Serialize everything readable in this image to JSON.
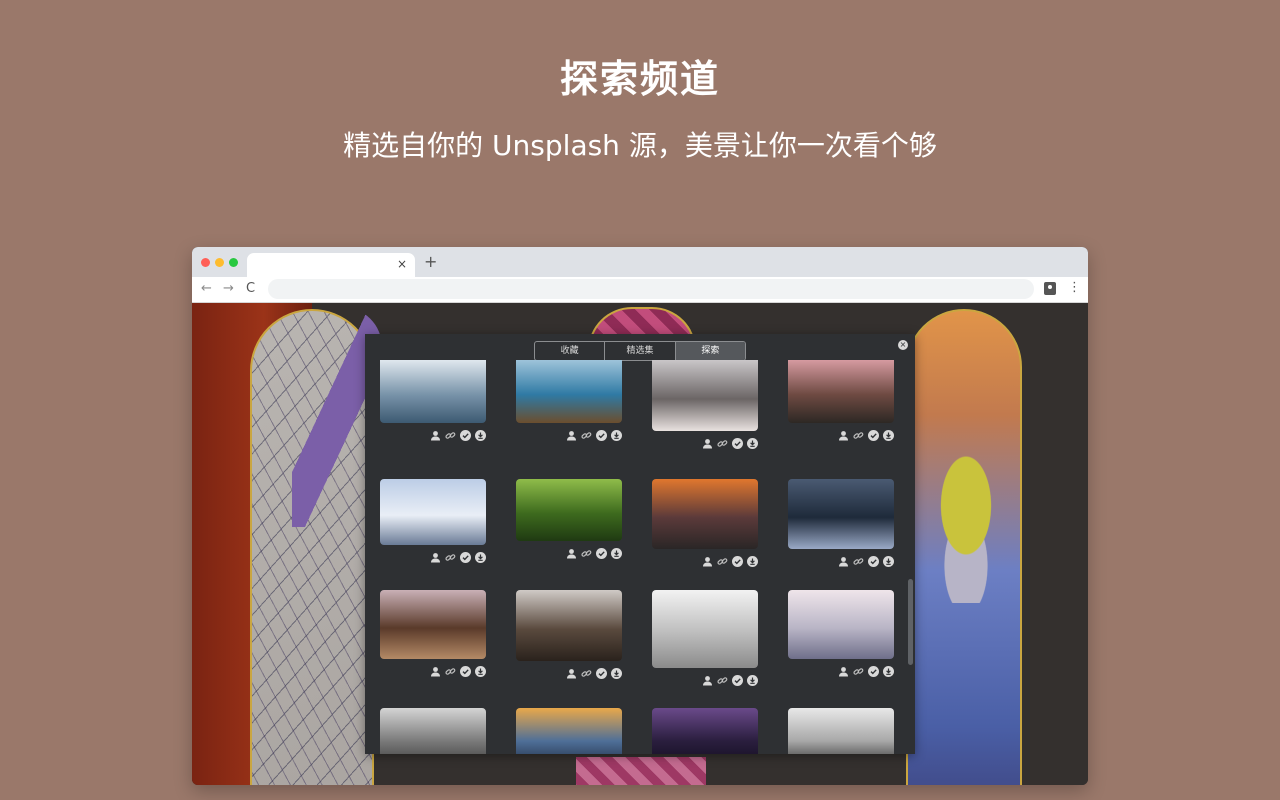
{
  "hero": {
    "title": "探索频道",
    "subtitle": "精选自你的 Unsplash 源，美景让你一次看个够"
  },
  "browser": {
    "tab_close": "×",
    "new_tab": "+",
    "nav_back": "←",
    "nav_forward": "→",
    "nav_reload": "C",
    "menu": "⋮"
  },
  "panel": {
    "tabs": [
      "收藏",
      "精选集",
      "探索"
    ],
    "active_tab": "探索",
    "close_icon": "×",
    "card_actions": [
      "user-icon",
      "link-icon",
      "check-icon",
      "download-icon"
    ],
    "photos": [
      {
        "subject": "misty blue mountains",
        "colors": [
          "#dfe7ee",
          "#7893a9",
          "#3d5a72"
        ]
      },
      {
        "subject": "crater lake with island",
        "colors": [
          "#9ec3da",
          "#2f7aa4",
          "#6b4e2e"
        ]
      },
      {
        "subject": "snowy castle on hill",
        "colors": [
          "#c9c6c8",
          "#6b6565",
          "#e9e2e0"
        ]
      },
      {
        "subject": "canyon at sunset",
        "colors": [
          "#d59aa0",
          "#6e4a42",
          "#2d2824"
        ]
      },
      {
        "subject": "snowy winter valley",
        "colors": [
          "#bccde6",
          "#e9eef6",
          "#6a7b96"
        ]
      },
      {
        "subject": "green rolling hills",
        "colors": [
          "#8fbc4a",
          "#3e6b1e",
          "#1f3a12"
        ]
      },
      {
        "subject": "sunset over sea arch",
        "colors": [
          "#e0772e",
          "#5b3a3a",
          "#2a2626"
        ]
      },
      {
        "subject": "lightning storm over city",
        "colors": [
          "#4a5a72",
          "#1e2a3a",
          "#9aa9c6"
        ]
      },
      {
        "subject": "desert butte",
        "colors": [
          "#c9b0b6",
          "#5a3a2a",
          "#b48a66"
        ]
      },
      {
        "subject": "foggy forest road",
        "colors": [
          "#cfcac6",
          "#5a4a3e",
          "#2a221c"
        ]
      },
      {
        "subject": "snow covered trees",
        "colors": [
          "#f2f2f2",
          "#bdbdbd",
          "#8b8b8b"
        ]
      },
      {
        "subject": "sea of clouds",
        "colors": [
          "#efe5ea",
          "#b9b5c6",
          "#6f6f8a"
        ]
      },
      {
        "subject": "snowy peaks",
        "colors": [
          "#d4d4d4",
          "#7a7a7a",
          "#3a3a3a"
        ]
      },
      {
        "subject": "mountain at golden hour",
        "colors": [
          "#e9a84a",
          "#4f6f98",
          "#1e2a40"
        ]
      },
      {
        "subject": "milky way night sky",
        "colors": [
          "#6a4a8a",
          "#2a1e3e",
          "#120c1e"
        ]
      },
      {
        "subject": "coastal highway",
        "colors": [
          "#e8e8e8",
          "#a8a8a8",
          "#2a2a2a"
        ]
      }
    ]
  }
}
